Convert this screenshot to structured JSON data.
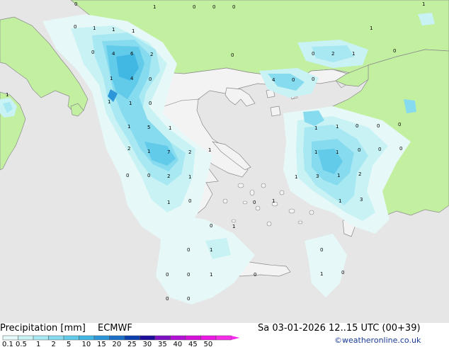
{
  "title": "Precipitation [mm]",
  "model": "ECMWF",
  "datetime": "Sa 03-01-2026 12..15 UTC (00+39)",
  "credit": "©weatheronline.co.uk",
  "colors": {
    "sea": "#e6e6e6",
    "land_in_domain": "#f3f3f3",
    "land_outside": "#c2f0a0",
    "coast": "#8a8a8a",
    "border": "#9b9b9b"
  },
  "legend": {
    "labels": [
      "0.1",
      "0.5",
      "1",
      "2",
      "5",
      "10",
      "15",
      "20",
      "25",
      "30",
      "35",
      "40",
      "45",
      "50"
    ],
    "colors": [
      "#e6f8f8",
      "#c9f2f5",
      "#a8e8f2",
      "#86dbef",
      "#63cbea",
      "#41b8e4",
      "#2c96d9",
      "#1a6ec8",
      "#0c3fae",
      "#1c0d9a",
      "#7d0fc4",
      "#b40fd6",
      "#d70fdb",
      "#ee16e4",
      "#f62ce8"
    ]
  },
  "values": [
    "0",
    "1",
    "1",
    "1",
    "1",
    "0",
    "0",
    "0",
    "0",
    "1",
    "0",
    "4",
    "6",
    "2",
    "0",
    "1",
    "4",
    "0",
    "1",
    "1",
    "1",
    "0",
    "5",
    "1",
    "1",
    "1",
    "2",
    "7",
    "2",
    "1",
    "0",
    "2",
    "1",
    "0",
    "0",
    "1",
    "0",
    "1",
    "0",
    "1",
    "0",
    "0",
    "1",
    "0",
    "0",
    "0",
    "0",
    "1",
    "0",
    "2",
    "1",
    "0",
    "4",
    "0",
    "0",
    "1",
    "1",
    "0",
    "0",
    "0",
    "1",
    "1",
    "1",
    "0",
    "0",
    "1",
    "3",
    "1",
    "2",
    "1",
    "3",
    "0",
    "0",
    "1",
    "0"
  ]
}
